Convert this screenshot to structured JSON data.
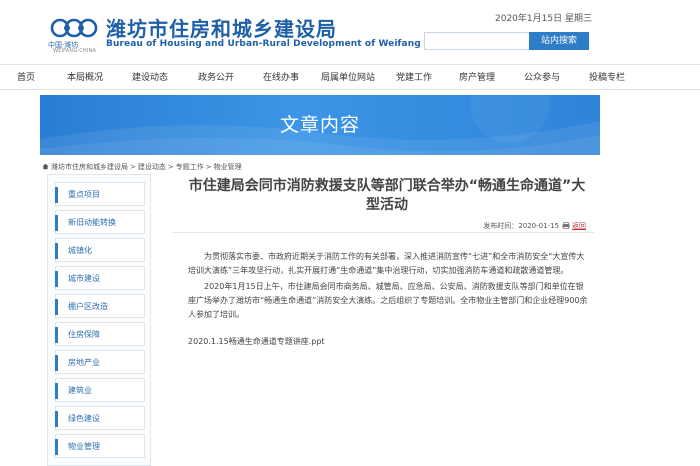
{
  "header": {
    "logo_caption": "中国·潍坊",
    "logo_caption_small": "WEIFANG·CHINA",
    "title_cn": "潍坊市住房和城乡建设局",
    "title_en": "Bureau of Housing and Urban-Rural Development of Weifang",
    "date": "2020年1月15日 星期三",
    "search_placeholder": "",
    "search_button": "站内搜索"
  },
  "nav": [
    "首页",
    "本局概况",
    "建设动态",
    "政务公开",
    "在线办事",
    "局属单位网站",
    "党建工作",
    "房产管理",
    "公众参与",
    "投稿专栏"
  ],
  "banner": {
    "title": "文章内容"
  },
  "breadcrumb": [
    "潍坊市住房和城乡建设局",
    ">",
    "建设动态",
    ">",
    "专题工作",
    ">",
    "物业管理"
  ],
  "sidebar": [
    "重点项目",
    "新旧动能转换",
    "城镇化",
    "城市建设",
    "棚户区改造",
    "住房保障",
    "房地产业",
    "建筑业",
    "绿色建设",
    "物业管理"
  ],
  "article": {
    "title": "市住建局会同市消防救援支队等部门联合举办“畅通生命通道”大型活动",
    "publish_label": "发布时间：",
    "publish_date": "2020-01-15",
    "back": "返回",
    "paragraphs": [
      "为贯彻落实市委、市政府近期关于消防工作的有关部署，深入推进消防宣传“七进”和全市消防安全“大宣传大培训大演练”三年攻坚行动，扎实开展打通“生命通道”集中治理行动，切实加强消防车通道和疏散通道管理。",
      "2020年1月15日上午，市住建局会同市商务局、城管局、应急局、公安局、消防救援支队等部门和单位在银座广场举办了潍坊市“畅通生命通道”消防安全大演练。之后组织了专题培训。全市物业主管部门和企业经理900余人参加了培训。"
    ],
    "attachment": "2020.1.15畅通生命通道专题讲座.ppt"
  },
  "colors": {
    "brand_blue": "#1f5fa8",
    "accent": "#2e7dc8",
    "back_link": "#b53030"
  }
}
